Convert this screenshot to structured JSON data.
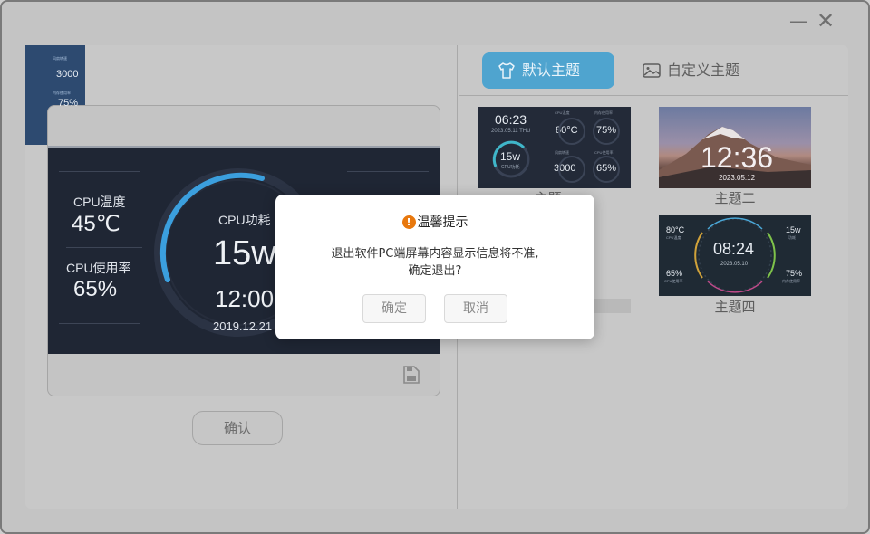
{
  "window": {
    "min_glyph": "—",
    "close_glyph": "✕"
  },
  "preview": {
    "cpu_temp_label": "CPU温度",
    "cpu_temp_value": "45℃",
    "cpu_usage_label": "CPU使用率",
    "cpu_usage_value": "65%",
    "cpu_power_label": "CPU功耗",
    "cpu_power_value": "15w",
    "time": "12:00",
    "date": "2019.12.21"
  },
  "confirm_label": "确认",
  "tabs": [
    {
      "label": "默认主题",
      "icon": "tshirt-icon",
      "active": true
    },
    {
      "label": "自定义主题",
      "icon": "image-icon",
      "active": false
    }
  ],
  "themes": [
    {
      "caption": "主题一",
      "time": "06:23",
      "date": "2023.05.11 THU",
      "power": "15w",
      "power_sub": "CPU功耗",
      "stats": [
        {
          "label": "CPU温度",
          "value": "80°C"
        },
        {
          "label": "内存使用率",
          "value": "75%"
        },
        {
          "label": "风扇转速",
          "value": "3000"
        },
        {
          "label": "CPU使用率",
          "value": "65%"
        }
      ]
    },
    {
      "caption": "主题二",
      "time": "12:36",
      "date": "2023.05.12"
    },
    {
      "stats": [
        {
          "label": "风扇转速",
          "value": "3000"
        },
        {
          "label": "内存使用率",
          "value": "75%"
        }
      ]
    },
    {
      "caption": "主题四",
      "time": "08:24",
      "date": "2023.05.10",
      "tl": "80°C",
      "tl_sub": "CPU温度",
      "tr": "15w",
      "tr_sub": "功耗",
      "bl": "65%",
      "bl_sub": "CPU使用率",
      "br": "75%",
      "br_sub": "内存使用率"
    }
  ],
  "dialog": {
    "title": "温馨提示",
    "message_line1": "退出软件PC端屏幕内容显示信息将不准,",
    "message_line2": "确定退出?",
    "ok": "确定",
    "cancel": "取消"
  },
  "colors": {
    "accent": "#4fa4cf",
    "warning": "#e8780d",
    "screen_bg": "#1f2634"
  }
}
